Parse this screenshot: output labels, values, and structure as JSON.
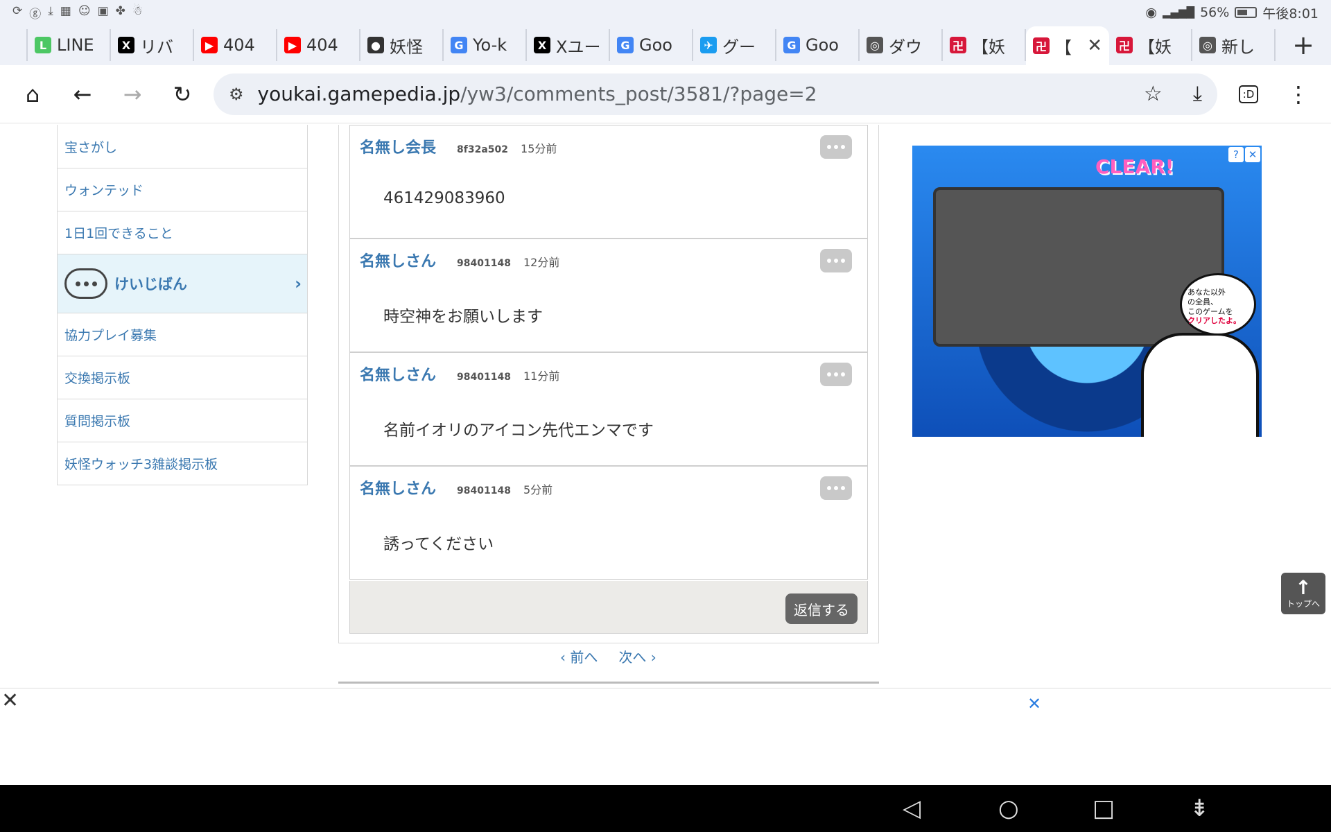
{
  "status": {
    "left_icons": [
      "⟳",
      "ⓖ",
      "⤓",
      "▦",
      "☺",
      "▣",
      "✤",
      "☃"
    ],
    "eye": "◉",
    "signal": "▂▄▆█",
    "battery_pct": "56%",
    "time": "午後8:01"
  },
  "tabs": [
    {
      "label": "LINE",
      "fav": "L",
      "color": "#4cc764"
    },
    {
      "label": "リバ",
      "fav": "X",
      "color": "#000000"
    },
    {
      "label": "404",
      "fav": "▶",
      "color": "#ff0000"
    },
    {
      "label": "404",
      "fav": "▶",
      "color": "#ff0000"
    },
    {
      "label": "妖怪",
      "fav": "●",
      "color": "#333333"
    },
    {
      "label": "Yo-k",
      "fav": "G",
      "color": "#4285f4"
    },
    {
      "label": "Xユー",
      "fav": "X",
      "color": "#000000"
    },
    {
      "label": "Goo",
      "fav": "G",
      "color": "#4285f4"
    },
    {
      "label": "グー",
      "fav": "✈",
      "color": "#1a9cf0"
    },
    {
      "label": "Goo",
      "fav": "G",
      "color": "#4285f4"
    },
    {
      "label": "ダウ",
      "fav": "◎",
      "color": "#555555"
    },
    {
      "label": "【妖",
      "fav": "卍",
      "color": "#d7173a"
    },
    {
      "label": "【",
      "fav": "卍",
      "color": "#d7173a",
      "active": true
    },
    {
      "label": "【妖",
      "fav": "卍",
      "color": "#d7173a"
    },
    {
      "label": "新し",
      "fav": "◎",
      "color": "#555555"
    }
  ],
  "toolbar": {
    "url_host": "youkai.gamepedia.jp",
    "url_path": "/yw3/comments_post/3581/?page=2",
    "home": "⌂",
    "back": "←",
    "forward": "→",
    "reload": "↻",
    "site_info": "⚙",
    "star": "☆",
    "download": "⤓",
    "tab_switcher": ":D",
    "menu": "⋮",
    "new_tab": "+",
    "tab_close": "✕"
  },
  "sidebar": {
    "items": [
      {
        "label": "宝さがし"
      },
      {
        "label": "ウォンテッド"
      },
      {
        "label": "1日1回できること"
      },
      {
        "label": "けいじばん",
        "active": true
      },
      {
        "label": "協力プレイ募集"
      },
      {
        "label": "交換掲示板"
      },
      {
        "label": "質問掲示板"
      },
      {
        "label": "妖怪ウォッチ3雑談掲示板"
      }
    ],
    "chevron": "›"
  },
  "comments": [
    {
      "name": "名無し会長",
      "id": "8f32a502",
      "time": "15分前",
      "body": "461429083960"
    },
    {
      "name": "名無しさん",
      "id": "98401148",
      "time": "12分前",
      "body": "時空神をお願いします"
    },
    {
      "name": "名無しさん",
      "id": "98401148",
      "time": "11分前",
      "body": "名前イオリのアイコン先代エンマです"
    },
    {
      "name": "名無しさん",
      "id": "98401148",
      "time": "5分前",
      "body": "誘ってください"
    }
  ],
  "reply_label": "返信する",
  "pager": {
    "prev": "‹ 前へ",
    "next": "次へ ›"
  },
  "ad": {
    "clear_text": "CLEAR!",
    "bubble_line1": "あなた以外",
    "bubble_line2": "の全員、",
    "bubble_line3": "このゲームを",
    "bubble_line4": "クリアしたよ。",
    "info": "?",
    "close": "✕"
  },
  "top_button": {
    "arrow": "↑",
    "label": "トップへ"
  },
  "bottom_ad": {
    "close": "✕",
    "x": "✕"
  },
  "nav": {
    "back": "◁",
    "home": "○",
    "recents": "□",
    "extra": "⇟"
  }
}
